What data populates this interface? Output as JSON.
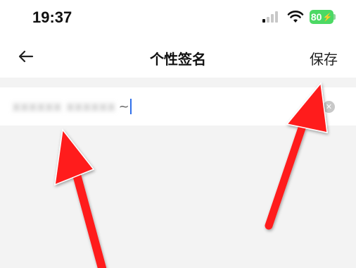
{
  "status_bar": {
    "time": "19:37",
    "battery_level": "80",
    "battery_color": "#4cd964",
    "icons": [
      "signal-icon",
      "wifi-icon",
      "battery-icon"
    ]
  },
  "nav_bar": {
    "back_icon": "arrow-left-icon",
    "title": "个性签名",
    "save_label": "保存"
  },
  "signature_field": {
    "blurred_value": "xxxxxx  xxxxxx",
    "visible_suffix": "~",
    "clear_icon": "clear-x-icon",
    "caret_color": "#2f6fea"
  },
  "annotations": {
    "arrow_color": "#ff1a1a",
    "arrow_count": 2
  }
}
